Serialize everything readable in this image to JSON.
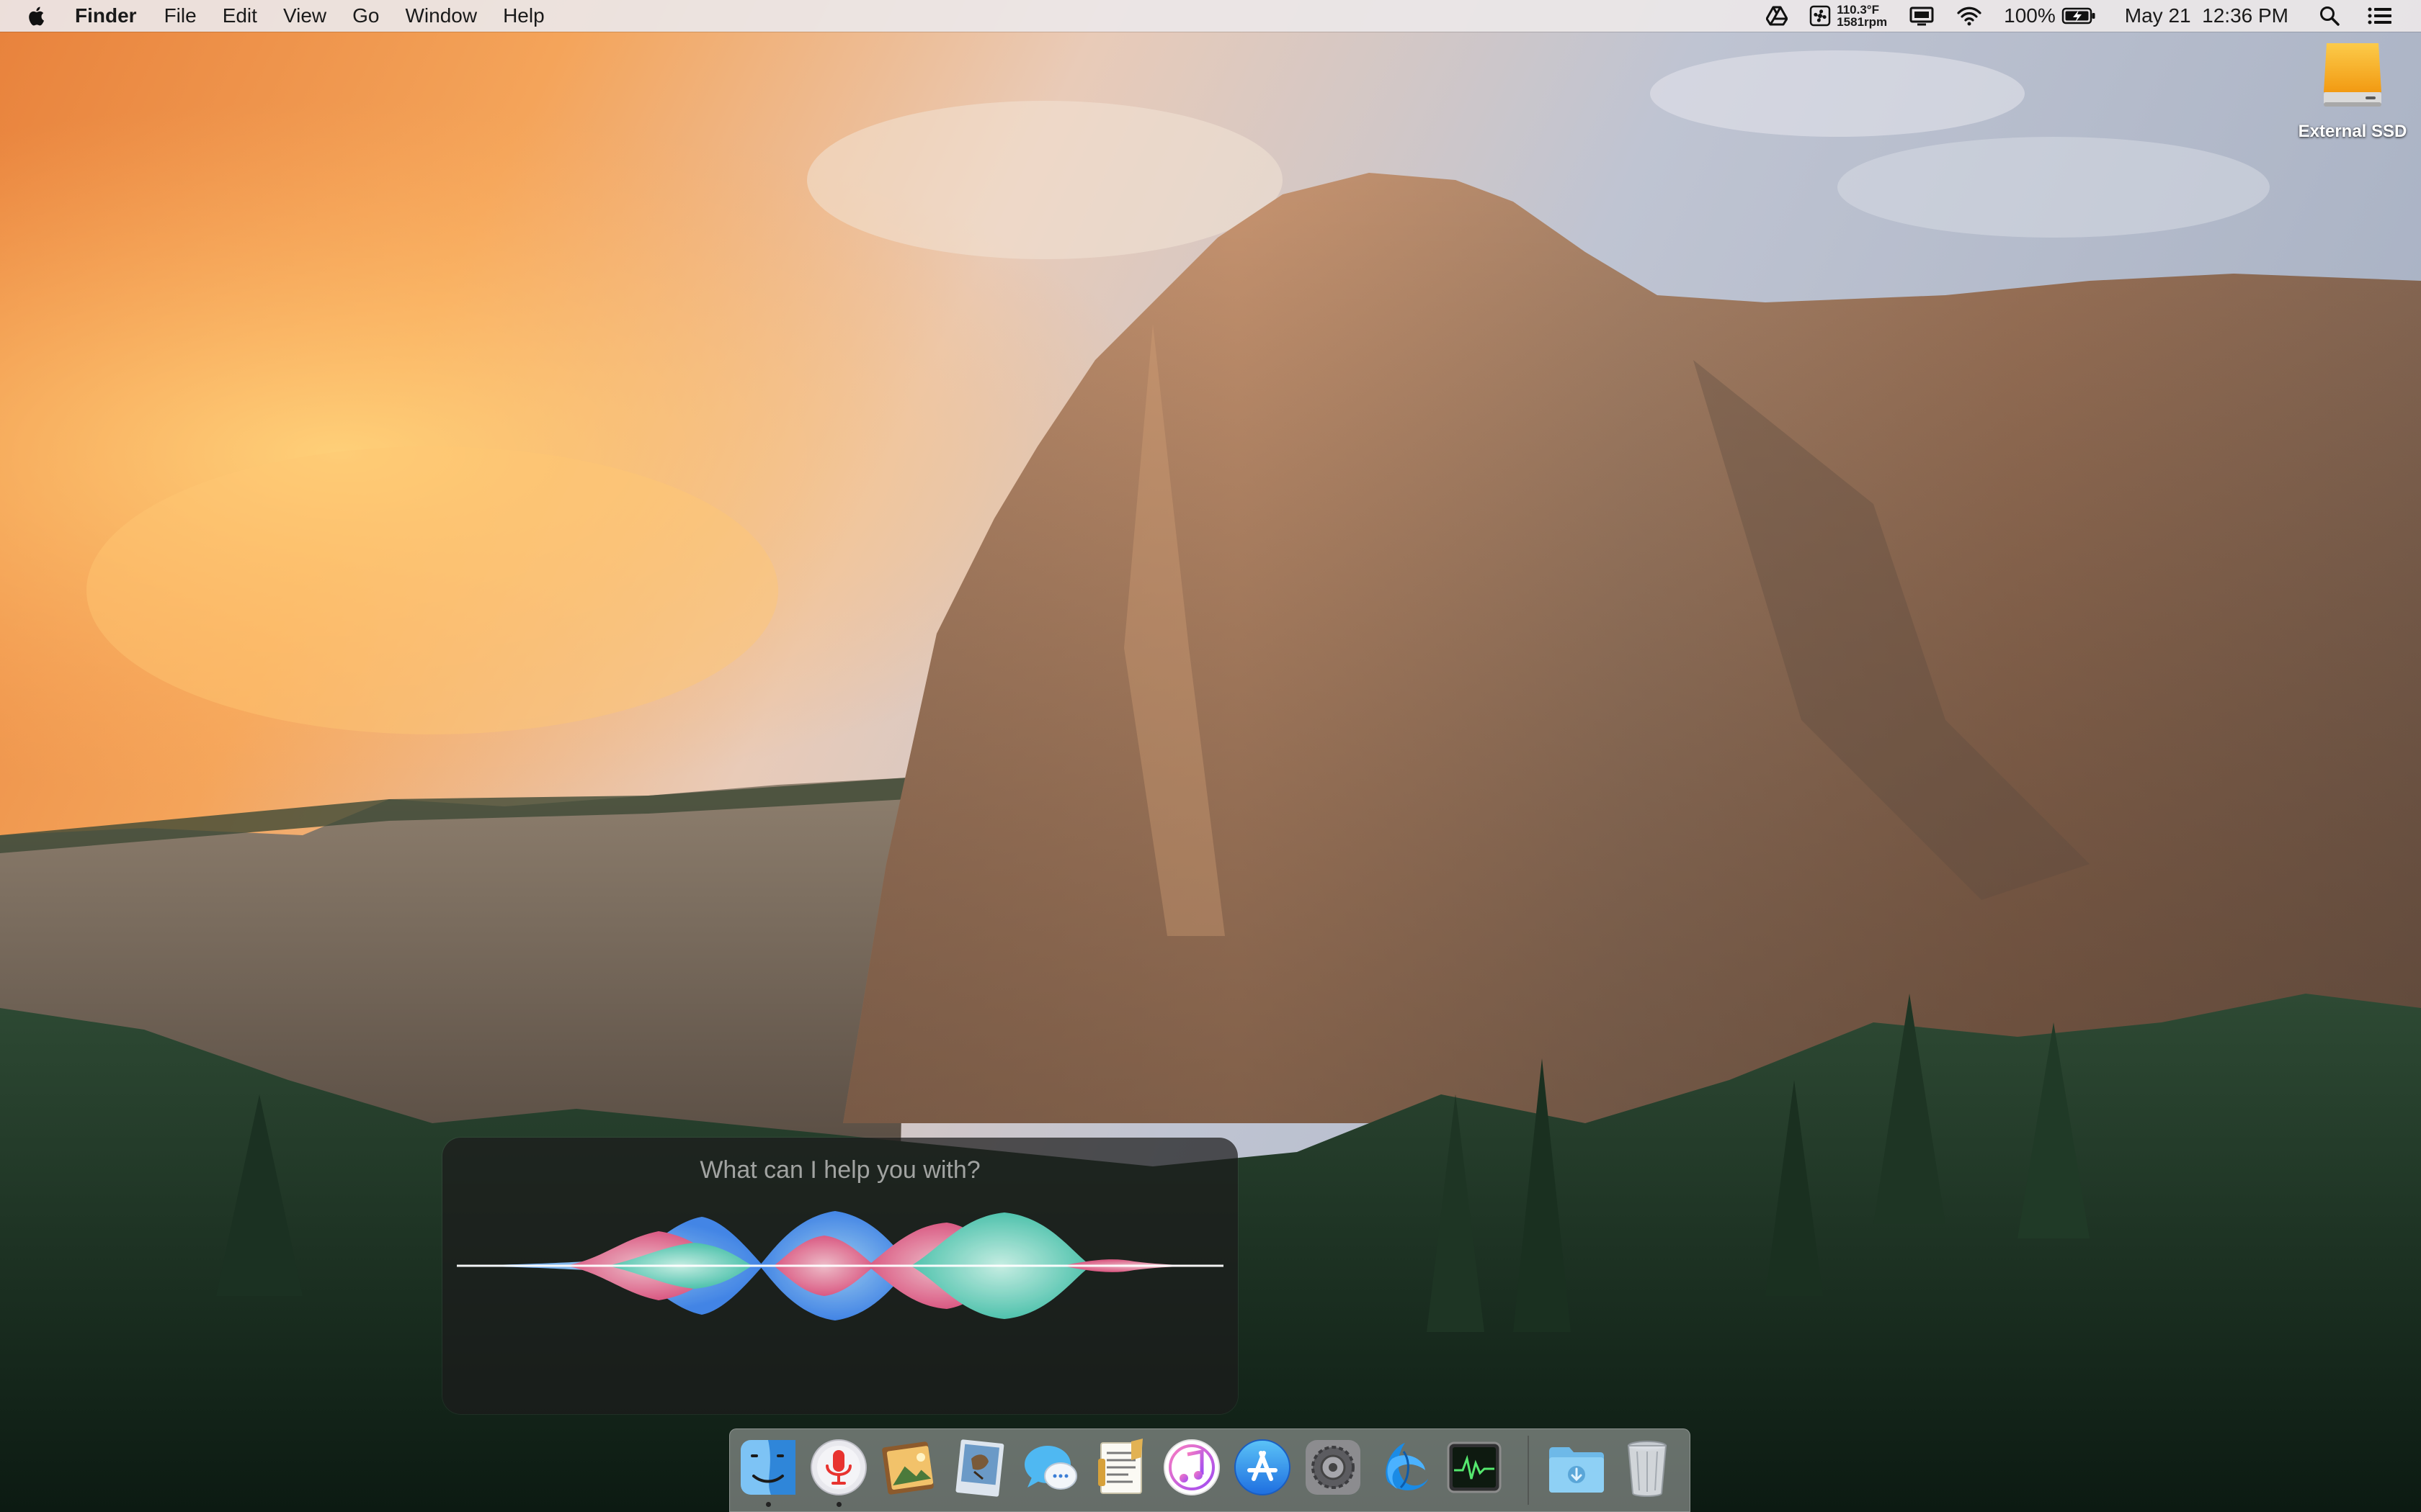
{
  "menubar": {
    "app_name": "Finder",
    "menus": [
      "File",
      "Edit",
      "View",
      "Go",
      "Window",
      "Help"
    ],
    "status": {
      "temperature": "110.3°F",
      "fan_speed": "1581rpm",
      "battery_percent": "100%",
      "datetime": "May 21  12:36 PM"
    }
  },
  "desktop": {
    "drive_label": "External SSD"
  },
  "siri": {
    "prompt": "What can I help you with?"
  },
  "dock": {
    "apps": [
      {
        "name": "finder-icon",
        "running": true
      },
      {
        "name": "siri-icon",
        "running": true
      },
      {
        "name": "photos-icon",
        "running": false
      },
      {
        "name": "mail-icon",
        "running": false
      },
      {
        "name": "messages-icon",
        "running": false
      },
      {
        "name": "textedit-icon",
        "running": false
      },
      {
        "name": "itunes-icon",
        "running": false
      },
      {
        "name": "app-store-icon",
        "running": false
      },
      {
        "name": "system-preferences-icon",
        "running": false
      },
      {
        "name": "battle-net-icon",
        "running": false
      },
      {
        "name": "activity-monitor-icon",
        "running": false
      },
      {
        "name": "downloads-folder-icon",
        "running": false
      },
      {
        "name": "trash-icon",
        "running": false
      }
    ]
  },
  "colors": {
    "menubar_bg": "#ECE7E8",
    "siri_blue": "#2F7CF6",
    "siri_pink": "#E8467C",
    "siri_teal": "#3FC9B0",
    "drive_orange": "#F6A81C"
  }
}
